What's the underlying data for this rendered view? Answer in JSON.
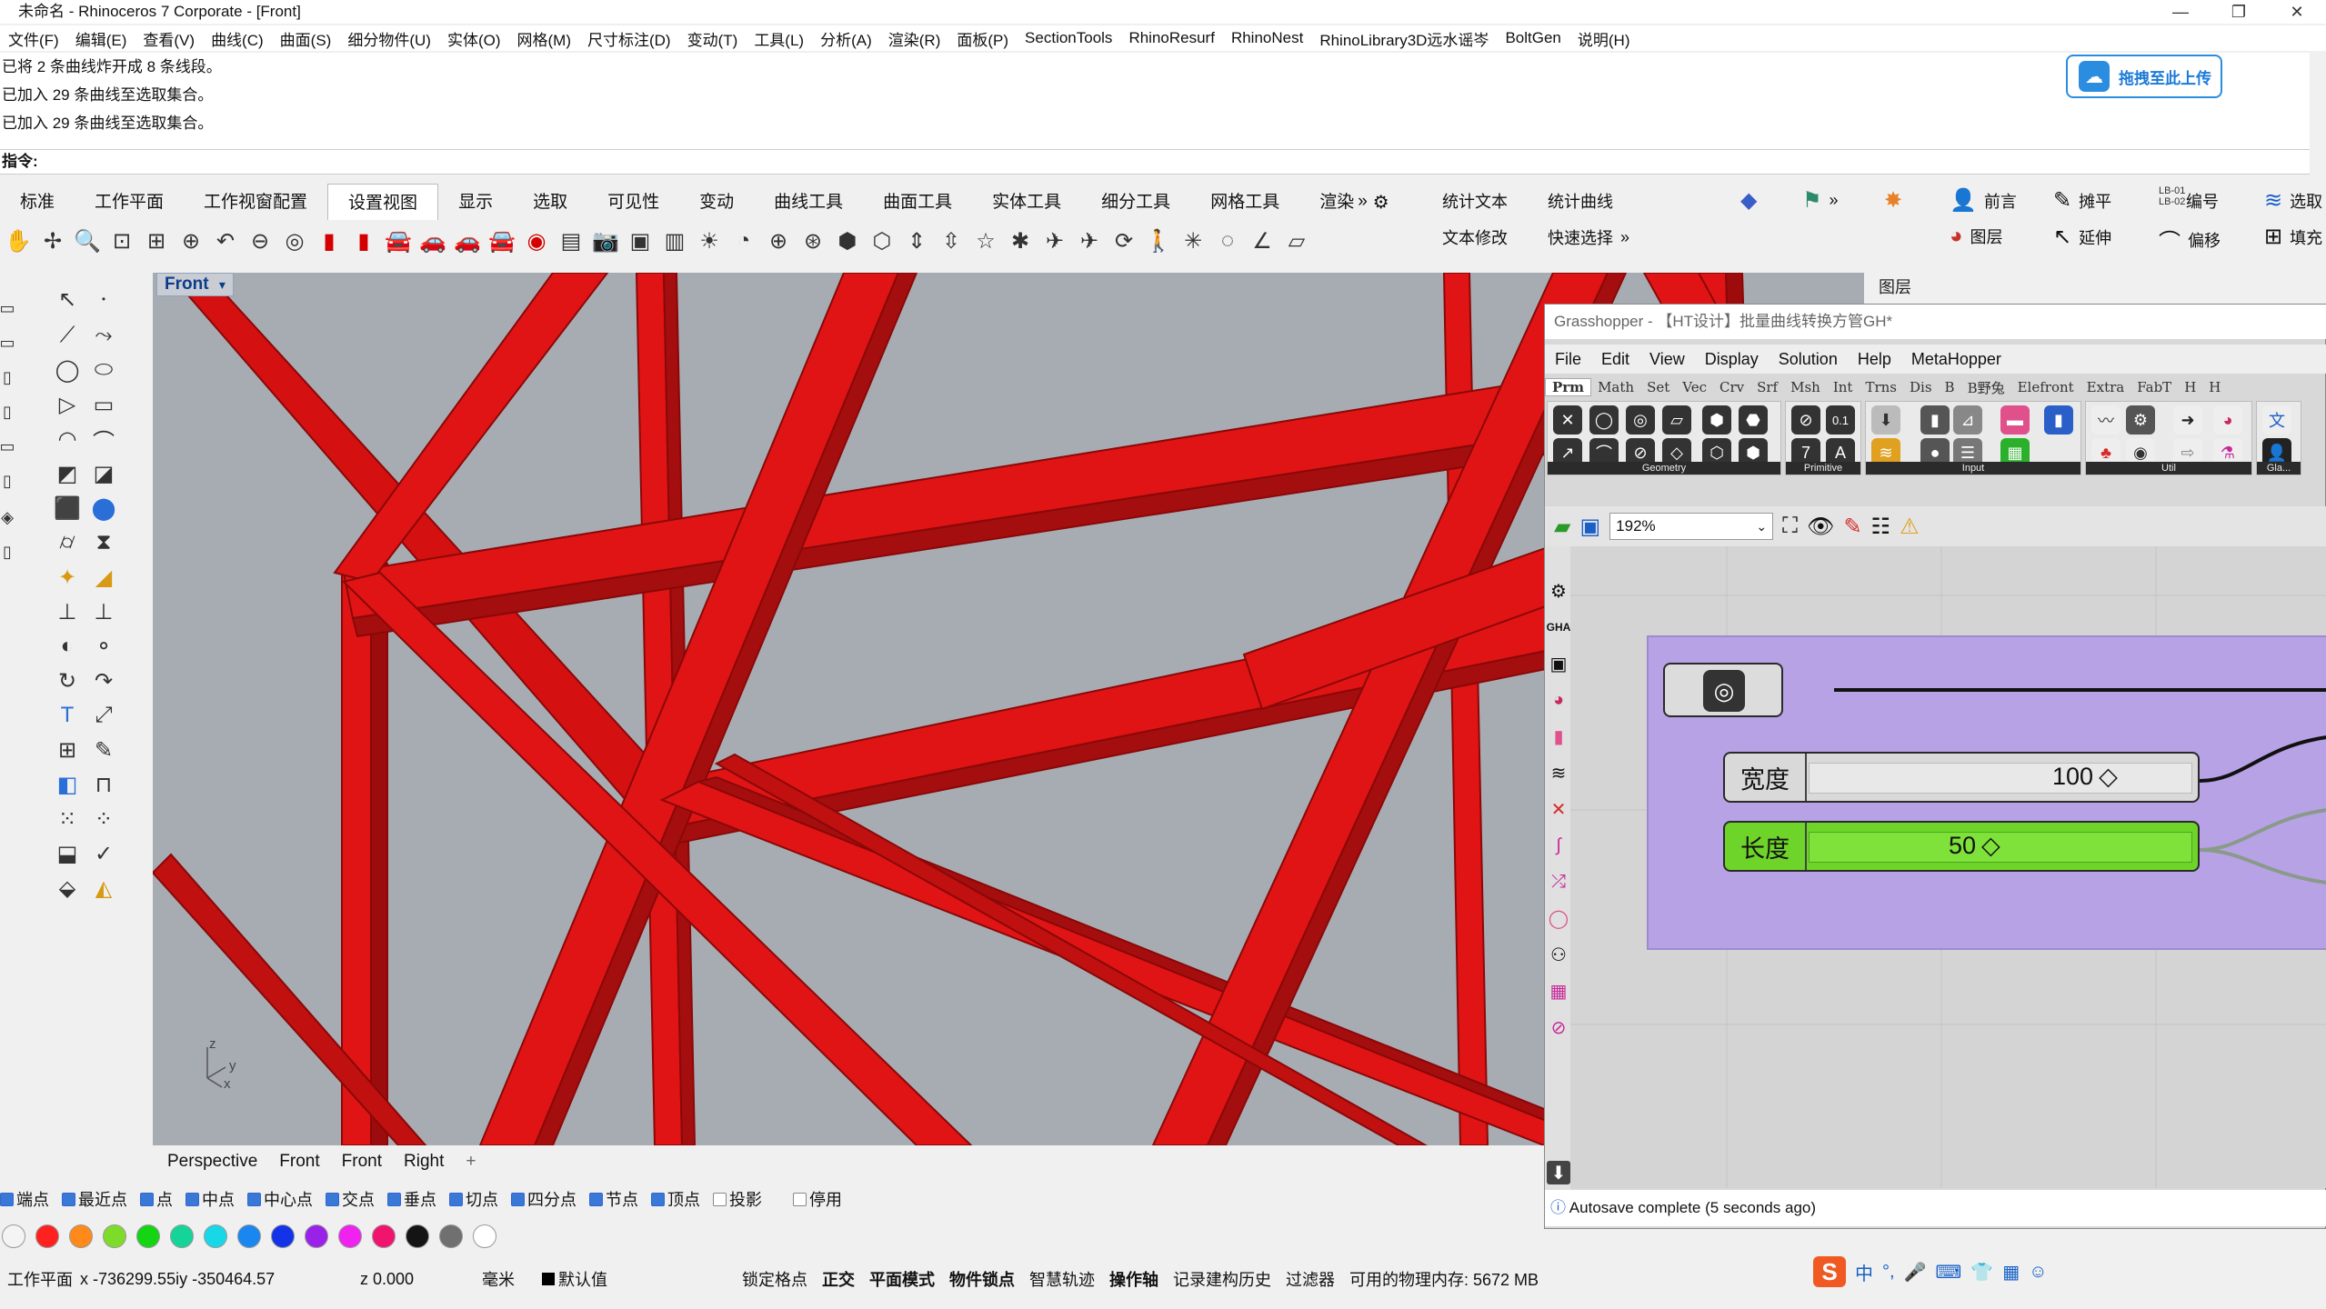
{
  "titlebar": {
    "title": "未命名 - Rhinoceros 7 Corporate - [Front]",
    "minimize": "—",
    "maximize": "❐",
    "close": "✕"
  },
  "menu": [
    "文件(F)",
    "编辑(E)",
    "查看(V)",
    "曲线(C)",
    "曲面(S)",
    "细分物件(U)",
    "实体(O)",
    "网格(M)",
    "尺寸标注(D)",
    "变动(T)",
    "工具(L)",
    "分析(A)",
    "渲染(R)",
    "面板(P)",
    "SectionTools",
    "RhinoResurf",
    "RhinoNest",
    "RhinoLibrary3D远水谣岑",
    "BoltGen",
    "说明(H)"
  ],
  "command_history": [
    "已将 2 条曲线炸开成 8 条线段。",
    "已加入 29 条曲线至选取集合。",
    "已加入 29 条曲线至选取集合。"
  ],
  "command_prompt": "指令:",
  "upload_button": "拖拽至此上传",
  "toolbar_tabs": [
    "标准",
    "工作平面",
    "工作视窗配置",
    "设置视图",
    "显示",
    "选取",
    "可见性",
    "变动",
    "曲线工具",
    "曲面工具",
    "实体工具",
    "细分工具",
    "网格工具",
    "渲染"
  ],
  "toolbar_tabs_overflow": "»",
  "right_tools": {
    "stat_text": "统计文本",
    "stat_curve": "统计曲线",
    "text_edit": "文本修改",
    "quick_select": "快速选择",
    "more": "»",
    "front": "前言",
    "layer": "图层",
    "spread": "摊平",
    "extend": "延伸",
    "number": "编号",
    "offset": "偏移",
    "select": "选取",
    "fill": "填充",
    "lb_tag1": "LB-01",
    "lb_tag2": "LB-02"
  },
  "layer_panel_label": "图层",
  "viewport": {
    "title": "Front",
    "axis_z": "z",
    "axis_y": "y",
    "axis_x": "x",
    "bg_color": "#a7acb3",
    "member_color": "#e01414"
  },
  "viewport_tabs": [
    "Perspective",
    "Front",
    "Front",
    "Right"
  ],
  "viewport_tab_add": "+",
  "osnaps": [
    {
      "label": "端点",
      "checked": true
    },
    {
      "label": "最近点",
      "checked": true
    },
    {
      "label": "点",
      "checked": true
    },
    {
      "label": "中点",
      "checked": true
    },
    {
      "label": "中心点",
      "checked": true
    },
    {
      "label": "交点",
      "checked": true
    },
    {
      "label": "垂点",
      "checked": true
    },
    {
      "label": "切点",
      "checked": true
    },
    {
      "label": "四分点",
      "checked": true
    },
    {
      "label": "节点",
      "checked": true
    },
    {
      "label": "顶点",
      "checked": true
    },
    {
      "label": "投影",
      "checked": false
    },
    {
      "label": "停用",
      "checked": false
    }
  ],
  "swatches": [
    "#f4f4f4",
    "#ff2020",
    "#ff8a1a",
    "#7ddc2a",
    "#14d414",
    "#14d49a",
    "#18d8e8",
    "#1a86f0",
    "#1432e8",
    "#9a22e8",
    "#f022f0",
    "#f0146e",
    "#141414",
    "#707070",
    "#ffffff"
  ],
  "statusbar": {
    "cplane": "工作平面",
    "coords": "x -736299.55iy -350464.57",
    "z": "z 0.000",
    "unit": "毫米",
    "layer": "默认值",
    "grid_snap": "锁定格点",
    "ortho": "正交",
    "planar": "平面模式",
    "osnap": "物件锁点",
    "smart_track": "智慧轨迹",
    "gumball": "操作轴",
    "history": "记录建构历史",
    "filter": "过滤器",
    "memory": "可用的物理内存: 5672 MB"
  },
  "grasshopper": {
    "title": "Grasshopper - 【HT设计】批量曲线转换方管GH*",
    "menu": [
      "File",
      "Edit",
      "View",
      "Display",
      "Solution",
      "Help",
      "MetaHopper"
    ],
    "categories": [
      "Prm",
      "Math",
      "Set",
      "Vec",
      "Crv",
      "Srf",
      "Msh",
      "Int",
      "Trns",
      "Dis",
      "B",
      "B野兔",
      "Elefront",
      "Extra",
      "FabT",
      "H",
      "H"
    ],
    "groups": [
      "Geometry",
      "Primitive",
      "Input",
      "Util",
      "Gla..."
    ],
    "zoom": "192%",
    "slider_width": {
      "name": "宽度",
      "value": "100",
      "color": "#d9d9d9"
    },
    "slider_length": {
      "name": "长度",
      "value": "50",
      "color": "#6fd42a"
    },
    "group_color": "#b8a2e6",
    "status": "Autosave complete (5 seconds ago)"
  },
  "ime": {
    "logo": "S",
    "lang": "中"
  }
}
